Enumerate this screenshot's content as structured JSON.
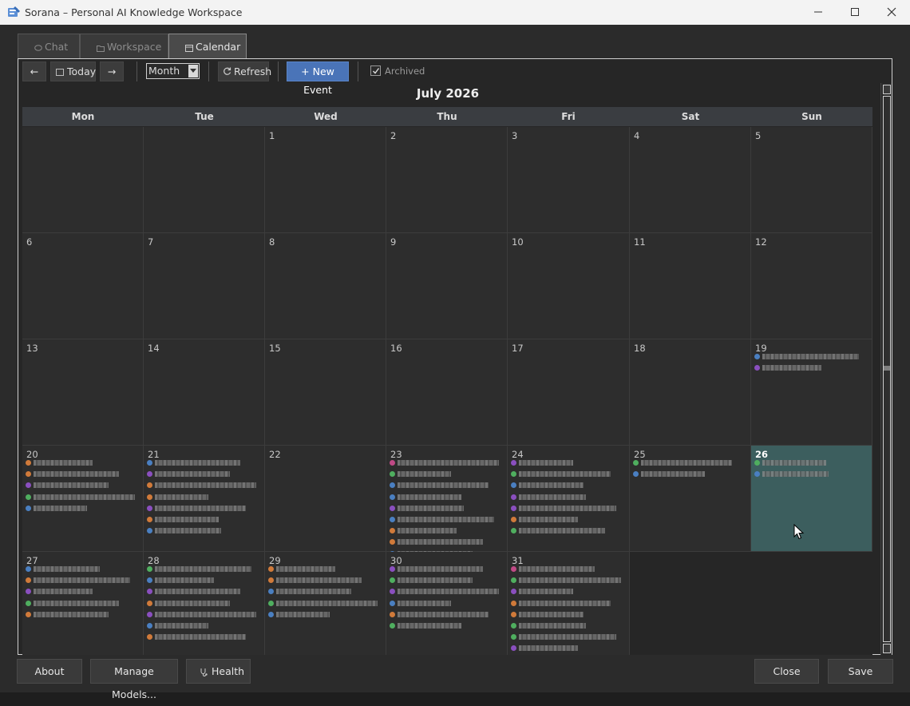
{
  "window": {
    "title": "Sorana – Personal AI Knowledge Workspace"
  },
  "tabs": [
    {
      "label": "Chat",
      "icon": "chat-bubble-icon",
      "active": false
    },
    {
      "label": "Workspace",
      "icon": "folder-icon",
      "active": false
    },
    {
      "label": "Calendar",
      "icon": "calendar-icon",
      "active": true
    }
  ],
  "toolbar": {
    "prev_label": "←",
    "today_label": "Today",
    "next_label": "→",
    "view_value": "Month",
    "refresh_label": "Refresh",
    "new_event_label": "+ New Event",
    "archived_label": "Archived",
    "archived_checked": true
  },
  "calendar": {
    "month_title": "July 2026",
    "weekdays": [
      "Mon",
      "Tue",
      "Wed",
      "Thu",
      "Fri",
      "Sat",
      "Sun"
    ],
    "today": 26,
    "weeks": [
      [
        null,
        null,
        1,
        2,
        3,
        4,
        5
      ],
      [
        6,
        7,
        8,
        9,
        10,
        11,
        12
      ],
      [
        13,
        14,
        15,
        16,
        17,
        18,
        19
      ],
      [
        20,
        21,
        22,
        23,
        24,
        25,
        26
      ],
      [
        27,
        28,
        29,
        30,
        31,
        null,
        null
      ]
    ],
    "event_colors": {
      "blue": "#4a7fc1",
      "orange": "#d07a3a",
      "purple": "#8a4fbf",
      "green": "#4fae5f",
      "pink": "#c04a86"
    },
    "events": {
      "19": [
        "blue",
        "purple"
      ],
      "20": [
        "orange",
        "orange",
        "purple",
        "green",
        "blue"
      ],
      "21": [
        "blue",
        "purple",
        "orange",
        "orange",
        "purple",
        "orange",
        "blue"
      ],
      "23": [
        "pink",
        "green",
        "blue",
        "blue",
        "purple",
        "blue",
        "orange",
        "orange",
        "blue"
      ],
      "24": [
        "purple",
        "green",
        "blue",
        "purple",
        "purple",
        "orange",
        "green"
      ],
      "25": [
        "green",
        "blue"
      ],
      "26": [
        "green",
        "blue"
      ],
      "27": [
        "blue",
        "orange",
        "purple",
        "green",
        "orange"
      ],
      "28": [
        "green",
        "blue",
        "purple",
        "orange",
        "purple",
        "blue",
        "orange"
      ],
      "29": [
        "orange",
        "orange",
        "blue",
        "green",
        "blue"
      ],
      "30": [
        "purple",
        "green",
        "purple",
        "blue",
        "orange",
        "green"
      ],
      "31": [
        "pink",
        "green",
        "purple",
        "orange",
        "orange",
        "green",
        "green",
        "purple",
        "green"
      ]
    }
  },
  "footer": {
    "about_label": "About",
    "manage_models_label": "Manage Models...",
    "health_label": "Health",
    "close_label": "Close",
    "save_label": "Save"
  }
}
